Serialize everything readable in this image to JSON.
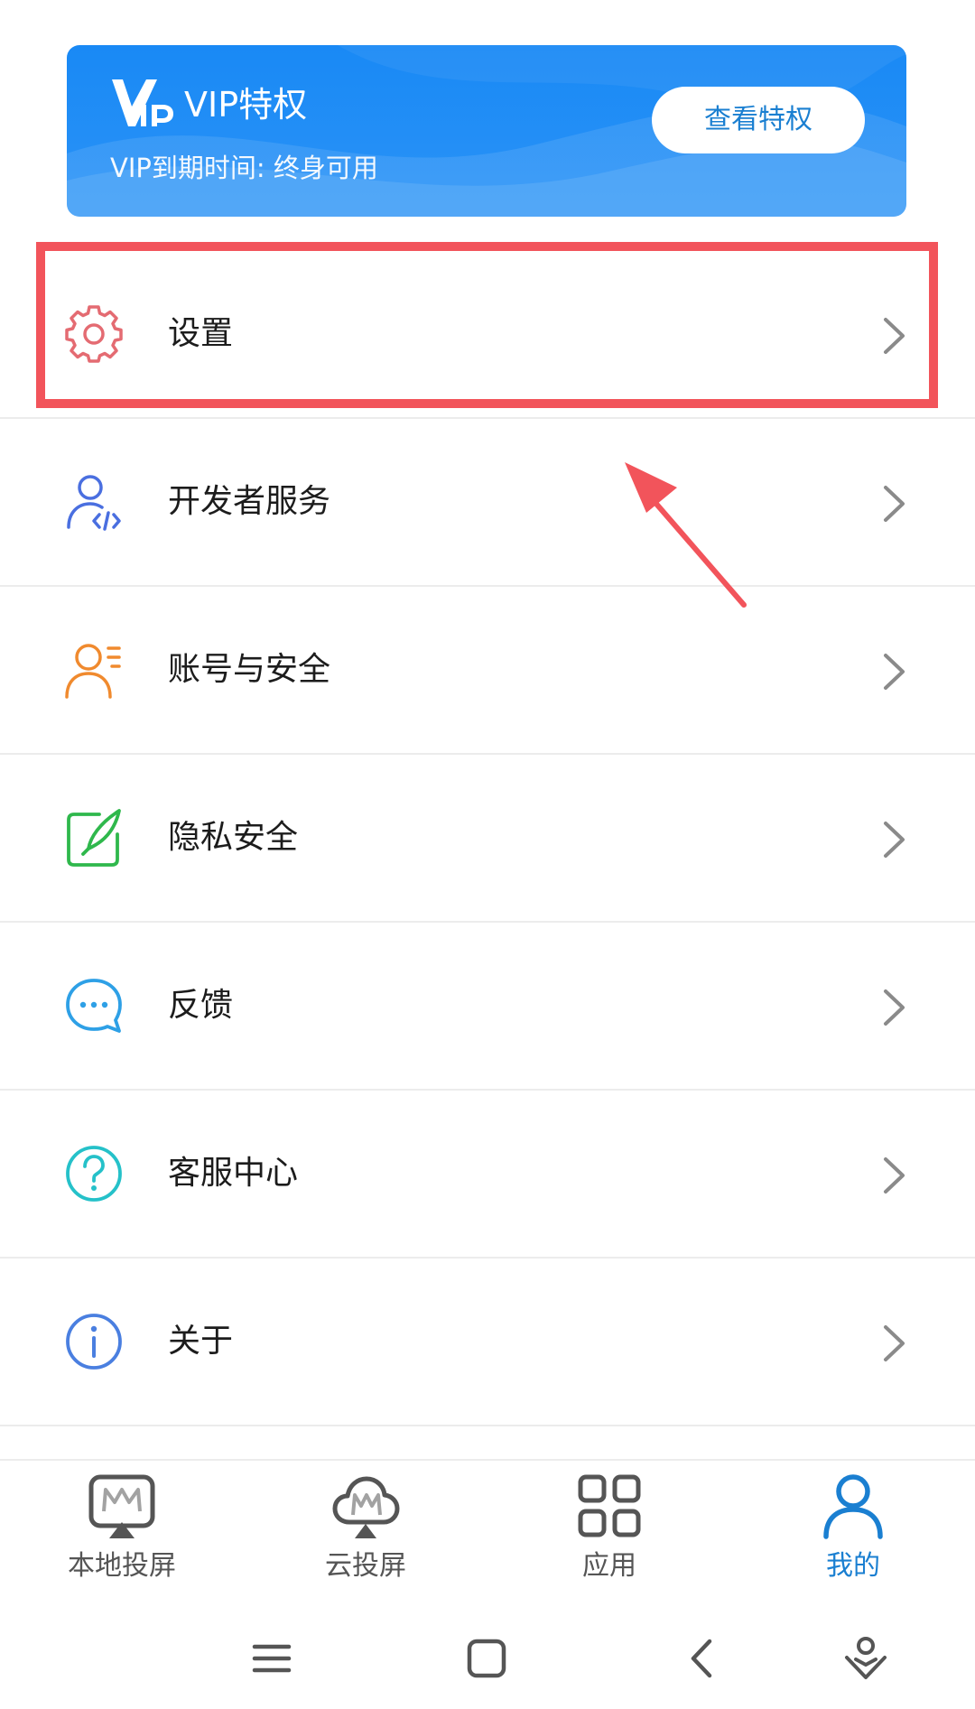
{
  "vip_banner": {
    "title": "VIP特权",
    "expiry": "VIP到期时间: 终身可用",
    "button_label": "查看特权"
  },
  "menu": {
    "items": [
      {
        "label": "设置",
        "icon": "gear-icon",
        "color": "#e46b72"
      },
      {
        "label": "开发者服务",
        "icon": "developer-icon",
        "color": "#4a6fe0"
      },
      {
        "label": "账号与安全",
        "icon": "account-icon",
        "color": "#f08a2e"
      },
      {
        "label": "隐私安全",
        "icon": "privacy-icon",
        "color": "#2fb84c"
      },
      {
        "label": "反馈",
        "icon": "feedback-icon",
        "color": "#2ea0e6"
      },
      {
        "label": "客服中心",
        "icon": "help-icon",
        "color": "#25c1c9"
      },
      {
        "label": "关于",
        "icon": "info-icon",
        "color": "#4a7fe0"
      }
    ]
  },
  "bottom_nav": {
    "tabs": [
      {
        "label": "本地投屏",
        "icon": "local-cast-icon",
        "active": false
      },
      {
        "label": "云投屏",
        "icon": "cloud-cast-icon",
        "active": false
      },
      {
        "label": "应用",
        "icon": "apps-grid-icon",
        "active": false
      },
      {
        "label": "我的",
        "icon": "profile-icon",
        "active": true
      }
    ]
  },
  "system_nav": {
    "buttons": [
      "menu-icon",
      "home-icon",
      "back-icon",
      "assistant-icon"
    ]
  },
  "colors": {
    "accent": "#1a7fd1",
    "highlight": "#f2545b",
    "banner": "#1989f5"
  }
}
